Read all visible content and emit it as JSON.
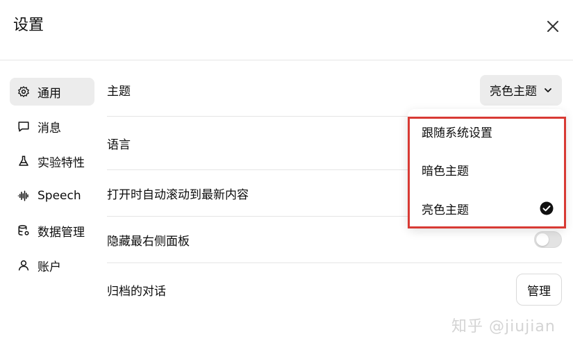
{
  "dialog": {
    "title": "设置",
    "close_icon": "close-icon"
  },
  "sidebar": {
    "items": [
      {
        "label": "通用",
        "icon": "gear-icon",
        "active": true
      },
      {
        "label": "消息",
        "icon": "chat-bubble-icon",
        "active": false
      },
      {
        "label": "实验特性",
        "icon": "flask-icon",
        "active": false
      },
      {
        "label": "Speech",
        "icon": "waveform-icon",
        "active": false
      },
      {
        "label": "数据管理",
        "icon": "database-gear-icon",
        "active": false
      },
      {
        "label": "账户",
        "icon": "user-icon",
        "active": false
      }
    ]
  },
  "settings": {
    "theme_label": "主题",
    "theme_value": "亮色主题",
    "language_label": "语言",
    "autoscroll_label": "打开时自动滚动到最新内容",
    "hide_panel_label": "隐藏最右侧面板",
    "hide_panel_on": false,
    "archived_label": "归档的对话",
    "manage_label": "管理"
  },
  "theme_dropdown": {
    "options": [
      {
        "label": "跟随系统设置",
        "selected": false
      },
      {
        "label": "暗色主题",
        "selected": false
      },
      {
        "label": "亮色主题",
        "selected": true
      }
    ],
    "highlight_color": "#d83a34"
  },
  "watermark": "知乎 @jiujian"
}
